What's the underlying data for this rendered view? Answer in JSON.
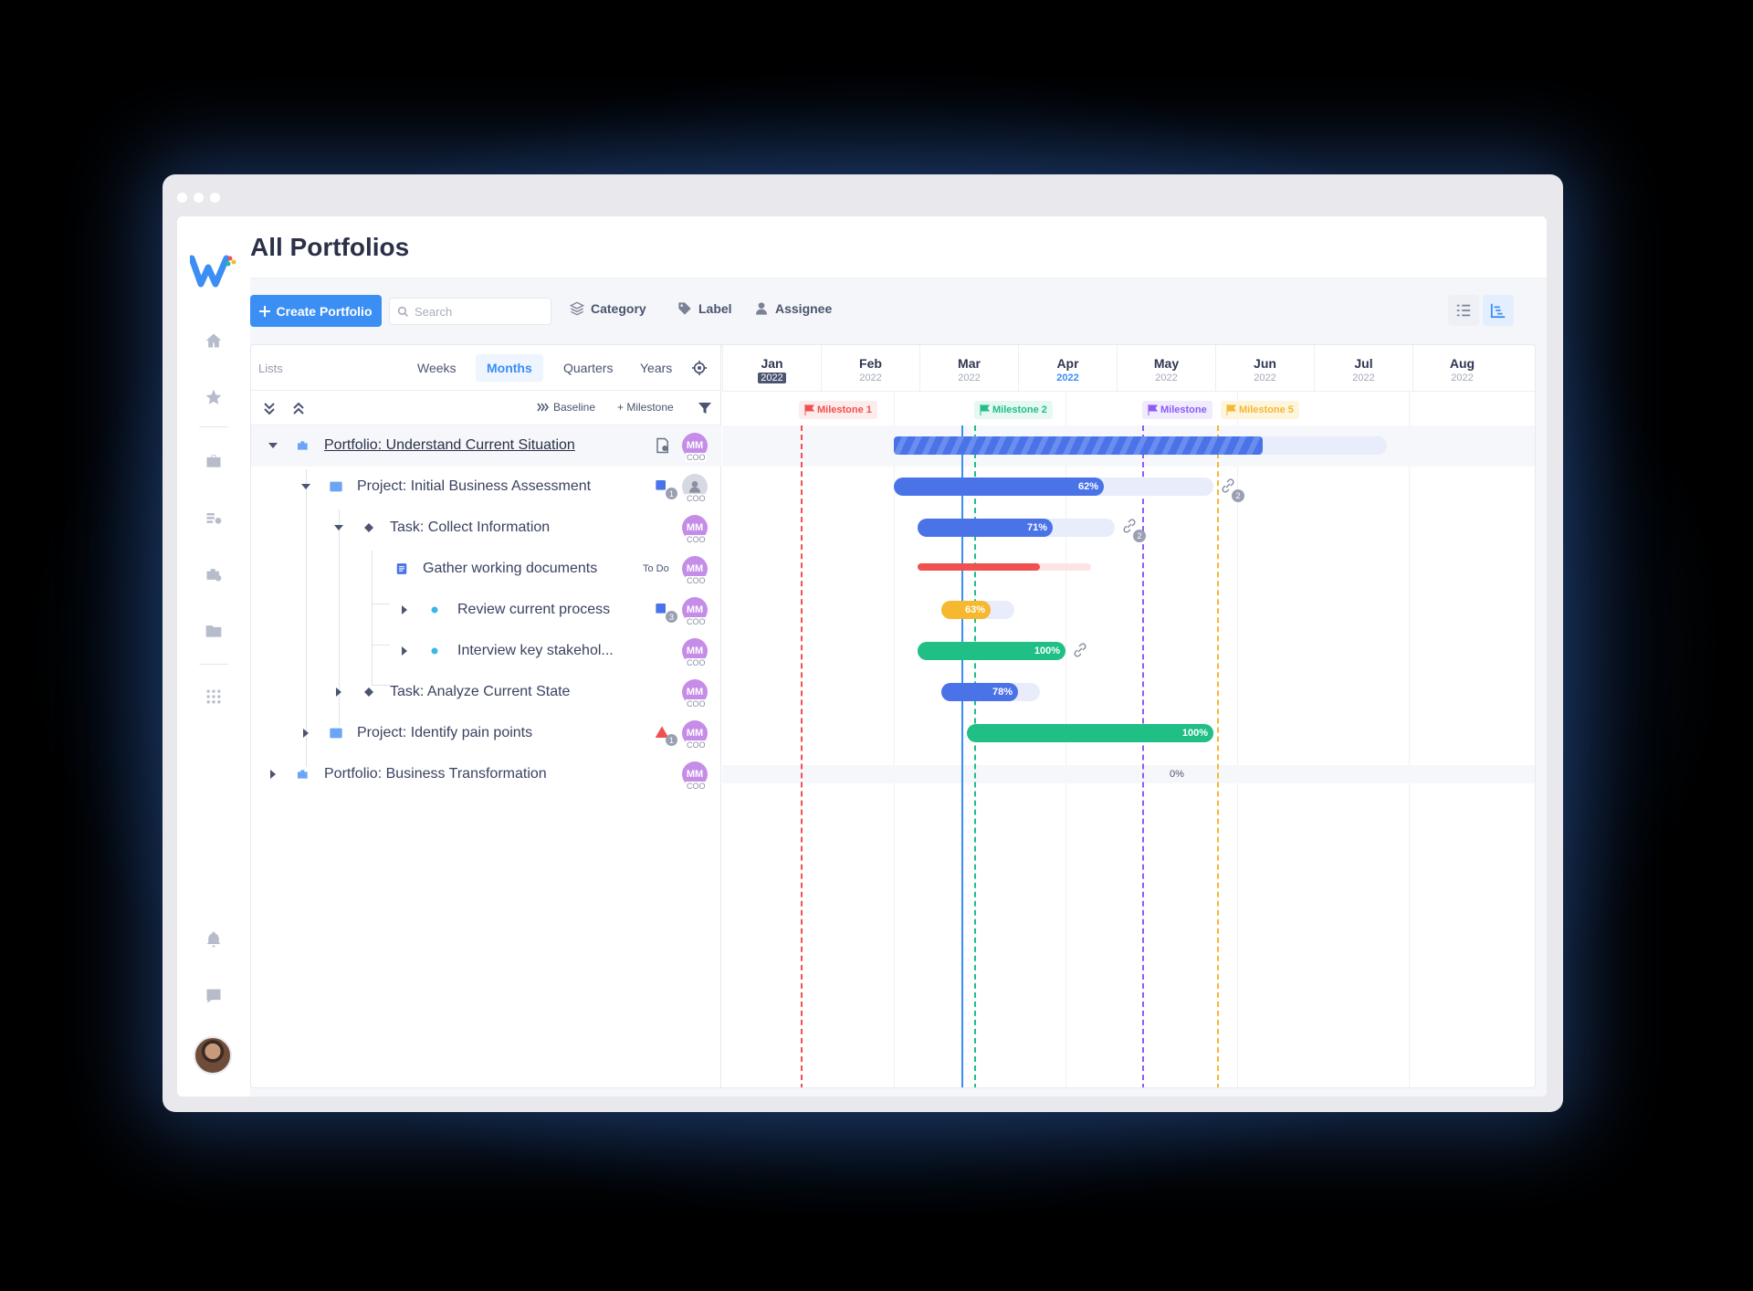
{
  "app": {
    "title": "All Portfolios"
  },
  "toolbar": {
    "create_label": "Create Portfolio",
    "search_placeholder": "Search",
    "category_label": "Category",
    "label_label": "Label",
    "assignee_label": "Assignee"
  },
  "gantt": {
    "lists_label": "Lists",
    "scales": [
      "Weeks",
      "Months",
      "Quarters",
      "Years"
    ],
    "active_scale": "Months",
    "baseline_label": "Baseline",
    "milestone_label": "+ Milestone",
    "months": [
      {
        "m": "Jan",
        "y": "2022"
      },
      {
        "m": "Feb",
        "y": "2022"
      },
      {
        "m": "Mar",
        "y": "2022"
      },
      {
        "m": "Apr",
        "y": "2022"
      },
      {
        "m": "May",
        "y": "2022"
      },
      {
        "m": "Jun",
        "y": "2022"
      },
      {
        "m": "Jul",
        "y": "2022"
      },
      {
        "m": "Aug",
        "y": "2022"
      }
    ],
    "milestones": [
      {
        "label": "Milestone 1",
        "color": "#f0504f"
      },
      {
        "label": "Milestone 2",
        "color": "#1fbf86"
      },
      {
        "label": "Milestone",
        "color": "#8b5cf6"
      },
      {
        "label": "Milestone 5",
        "color": "#f5b82e"
      }
    ],
    "rows": [
      {
        "name": "Portfolio: Understand Current Situation",
        "avatar": "MM",
        "role": "COO"
      },
      {
        "name": "Project: Initial Business Assessment",
        "avatar": "",
        "role": "COO",
        "badge": "1",
        "percent": "62%",
        "link_count": "2"
      },
      {
        "name": "Task: Collect Information",
        "avatar": "MM",
        "role": "COO",
        "percent": "71%",
        "link_count": "2"
      },
      {
        "name": "Gather working documents",
        "avatar": "MM",
        "role": "COO",
        "status": "To Do"
      },
      {
        "name": "Review current process",
        "avatar": "MM",
        "role": "COO",
        "badge": "3",
        "percent": "63%"
      },
      {
        "name": "Interview key stakehol...",
        "avatar": "MM",
        "role": "COO",
        "percent": "100%"
      },
      {
        "name": "Task: Analyze Current State",
        "avatar": "MM",
        "role": "COO",
        "percent": "78%"
      },
      {
        "name": "Project: Identify pain points",
        "avatar": "MM",
        "role": "COO",
        "badge": "1",
        "percent": "100%"
      },
      {
        "name": "Portfolio: Business Transformation",
        "avatar": "MM",
        "role": "COO",
        "percent": "0%"
      }
    ]
  },
  "colors": {
    "accent": "#3b8ef3",
    "bar_blue": "#4a73e8",
    "bar_green": "#1fbf86",
    "bar_red": "#f0504f",
    "bar_yellow": "#f5b82e",
    "avatar_purple": "#c58de8"
  }
}
